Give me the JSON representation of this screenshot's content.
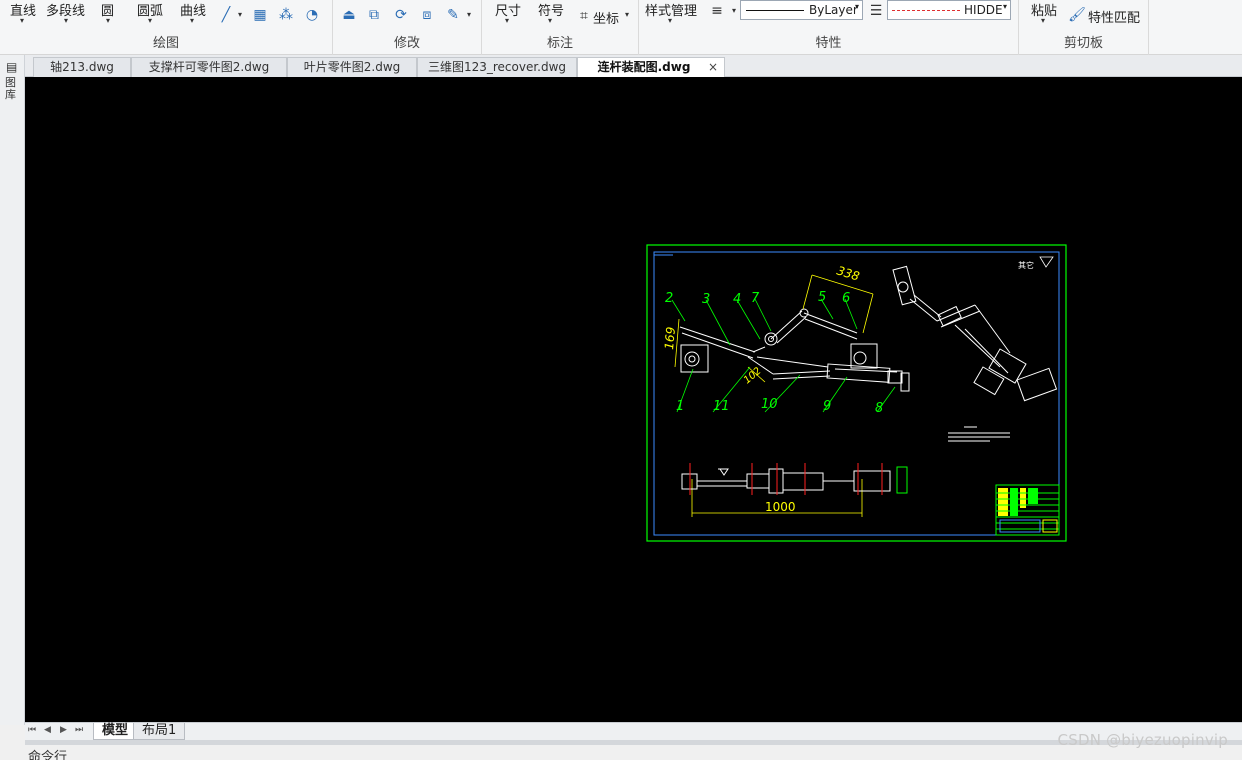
{
  "ribbon": {
    "draw_panel": {
      "title": "绘图",
      "line": "直线",
      "polyline": "多段线",
      "circle": "圆",
      "arc": "圆弧",
      "curve": "曲线"
    },
    "modify_panel": {
      "title": "修改"
    },
    "annotate_panel": {
      "title": "标注",
      "dimension": "尺寸",
      "symbol": "符号",
      "coordinate": "坐标"
    },
    "properties_panel": {
      "title": "特性",
      "style_manager": "样式管理",
      "lineweight_value": "ByLayer",
      "linetype_value": "HIDDE"
    },
    "clipboard_panel": {
      "title": "剪切板",
      "paste": "粘贴",
      "match_properties": "特性匹配"
    }
  },
  "left_strip": {
    "label": "图库"
  },
  "tabs": [
    {
      "label": "轴213.dwg",
      "active": false
    },
    {
      "label": "支撑杆可零件图2.dwg",
      "active": false
    },
    {
      "label": "叶片零件图2.dwg",
      "active": false
    },
    {
      "label": "三维图123_recover.dwg",
      "active": false
    },
    {
      "label": "连杆装配图.dwg",
      "active": true,
      "close": "×"
    }
  ],
  "drawing": {
    "corner_text": "其它",
    "dim_top": "338",
    "dim_left": "169",
    "dim_mid": "102",
    "dim_bottom": "1000",
    "part_numbers": [
      "1",
      "2",
      "3",
      "4",
      "7",
      "5",
      "6",
      "11",
      "10",
      "9",
      "8"
    ],
    "colors": {
      "frame": "#00ff00",
      "inner_frame": "#3c8cff",
      "linework": "#ffffff",
      "dims": "#ffff00",
      "callouts": "#00ff00",
      "centerline": "#ff2020"
    }
  },
  "layout_tabs": [
    {
      "label": "模型",
      "active": true
    },
    {
      "label": "布局1",
      "active": false
    }
  ],
  "command_line": {
    "label": "命令行"
  },
  "watermark": "CSDN @biyezuopinvip"
}
